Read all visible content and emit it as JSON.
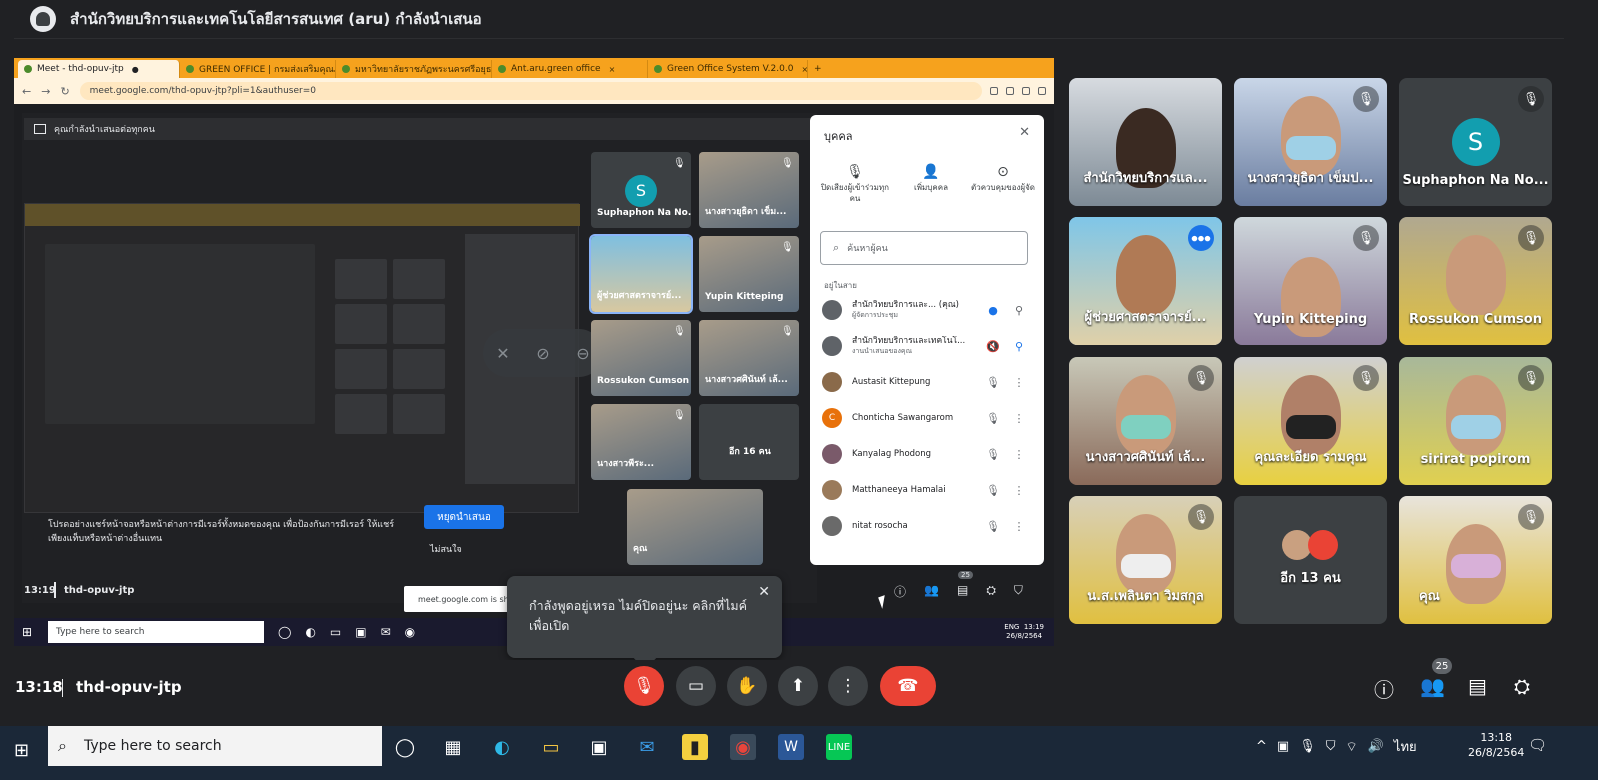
{
  "presenter": {
    "title": "สำนักวิทยบริการและเทคโนโลยีสารสนเทศ (aru) กำลังนำเสนอ"
  },
  "browser": {
    "tabs": [
      {
        "label": "Meet - thd-opuv-jtp"
      },
      {
        "label": "GREEN OFFICE | กรมส่งเสริมคุณภาพ..."
      },
      {
        "label": "มหาวิทยาลัยราชภัฏพระนครศรีอยุธยา"
      },
      {
        "label": "Ant.aru.green office"
      },
      {
        "label": "Green Office System V.2.0.0"
      }
    ],
    "url": "meet.google.com/thd-opuv-jtp?pli=1&authuser=0"
  },
  "inner": {
    "present_banner": "คุณกำลังนำเสนอต่อทุกคน",
    "hint": "โปรดอย่างแชร์หน้าจอหรือหน้าต่างการมีเรอร์ทั้งหมดของคุณ เพื่อป้องกันการมีเรอร์ ให้แชร์เพียงแท็บหรือหน้าต่างอื่นแทน",
    "stop_button": "หยุดนำเสนอ",
    "not_interested": "ไม่สนใจ",
    "time": "13:19",
    "code": "thd-opuv-jtp",
    "chrome_snack": "meet.google.com is shar",
    "tiles": [
      {
        "name": "Suphaphon Na No...",
        "initial": "S"
      },
      {
        "name": "นางสาวยุธิดา เข็ม..."
      },
      {
        "name": "ผู้ช่วยศาสตราจารย์..."
      },
      {
        "name": "Yupin Kitteping"
      },
      {
        "name": "Rossukon Cumson"
      },
      {
        "name": "นางสาวศศินันท์ เล้..."
      },
      {
        "name": "นางสาวพีระ..."
      },
      {
        "name": "อีก 16 คน"
      },
      {
        "name": "คุณ"
      }
    ],
    "badge": "25",
    "taskbar": {
      "search": "Type here to search",
      "lang": "ENG",
      "time": "13:19",
      "date": "26/8/2564"
    }
  },
  "people_panel": {
    "title": "บุคคล",
    "actions": [
      {
        "label": "ปิดเสียงผู้เข้าร่วมทุกคน"
      },
      {
        "label": "เพิ่มบุคคล"
      },
      {
        "label": "ตัวควบคุมของผู้จัด"
      }
    ],
    "search_placeholder": "ค้นหาผู้คน",
    "section": "อยู่ในสาย",
    "people": [
      {
        "name": "สำนักวิทยบริการและ...  (คุณ)",
        "sub": "ผู้จัดการประชุม"
      },
      {
        "name": "สำนักวิทยบริการและเทคโนโ...",
        "sub": "งานนำเสนอของคุณ"
      },
      {
        "name": "Austasit Kittepung",
        "sub": ""
      },
      {
        "name": "Chonticha Sawangarom",
        "sub": "",
        "initial": "C"
      },
      {
        "name": "Kanyalag Phodong",
        "sub": ""
      },
      {
        "name": "Matthaneeya Hamalai",
        "sub": ""
      },
      {
        "name": "nitat rosocha",
        "sub": ""
      }
    ]
  },
  "toast": {
    "text": "กำลังพูดอยู่เหรอ ไมค์ปิดอยู่นะ คลิกที่ไมค์เพื่อเปิด"
  },
  "grid": [
    {
      "name": "สำนักวิทยบริการแล..."
    },
    {
      "name": "นางสาวยุธิดา เข็มป..."
    },
    {
      "name": "Suphaphon Na No...",
      "initial": "S"
    },
    {
      "name": "ผู้ช่วยศาสตราจารย์..."
    },
    {
      "name": "Yupin Kitteping"
    },
    {
      "name": "Rossukon Cumson"
    },
    {
      "name": "นางสาวศศินันท์ เล้..."
    },
    {
      "name": "คุณละเอียด รามคุณ"
    },
    {
      "name": "sirirat popirom"
    },
    {
      "name": "น.ส.เพลินตา วิมสกุล"
    },
    {
      "name": "อีก 13 คน"
    },
    {
      "name": "คุณ"
    }
  ],
  "meeting": {
    "time": "13:18",
    "code": "thd-opuv-jtp",
    "people_badge": "25"
  },
  "taskbar": {
    "search": "Type here to search",
    "lang": "ไทย",
    "time": "13:18",
    "date": "26/8/2564"
  },
  "colors": {
    "accent_blue": "#8ab4f8",
    "red": "#ea4335",
    "avatar_teal": "#129eaf"
  }
}
